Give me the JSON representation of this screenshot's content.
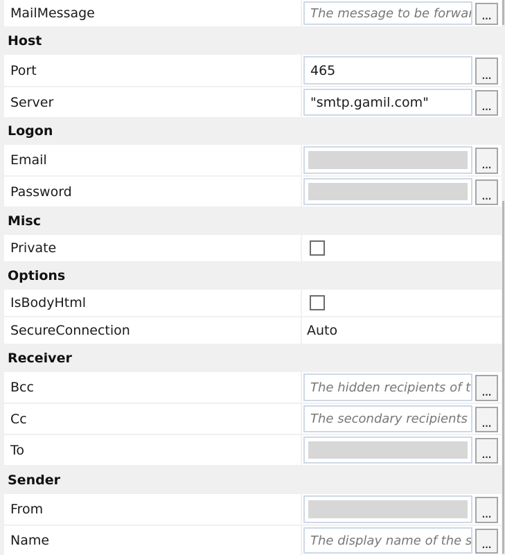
{
  "properties": {
    "mailmessage": {
      "label": "MailMessage",
      "placeholder": "The message to be forwarded"
    },
    "host": {
      "category": "Host",
      "port": {
        "label": "Port",
        "value": "465"
      },
      "server": {
        "label": "Server",
        "value": "\"smtp.gamil.com\""
      }
    },
    "logon": {
      "category": "Logon",
      "email": {
        "label": "Email",
        "value": "[redacted]"
      },
      "password": {
        "label": "Password",
        "value": "[redacted]"
      }
    },
    "misc": {
      "category": "Misc",
      "private": {
        "label": "Private",
        "checked": false
      }
    },
    "options": {
      "category": "Options",
      "isbodyhtml": {
        "label": "IsBodyHtml",
        "checked": false
      },
      "secureconnection": {
        "label": "SecureConnection",
        "value": "Auto"
      }
    },
    "receiver": {
      "category": "Receiver",
      "bcc": {
        "label": "Bcc",
        "placeholder": "The hidden recipients of the email message"
      },
      "cc": {
        "label": "Cc",
        "placeholder": "The secondary recipients of the email message"
      },
      "to": {
        "label": "To",
        "value": "[redacted]"
      }
    },
    "sender": {
      "category": "Sender",
      "from": {
        "label": "From",
        "value": "[redacted]"
      },
      "name": {
        "label": "Name",
        "placeholder": "The display name of the sender"
      }
    },
    "ellipsis_label": "..."
  }
}
